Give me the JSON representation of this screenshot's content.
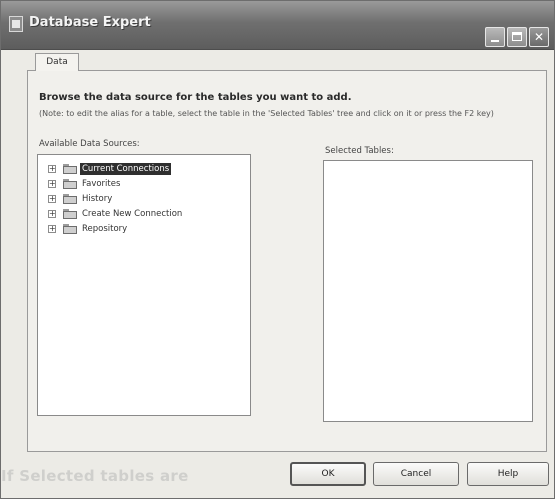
{
  "window": {
    "title": "Database Expert",
    "controls": {
      "minimize_icon": "minimize-icon",
      "maximize_icon": "maximize-icon",
      "close_label": "✕"
    }
  },
  "tabs": [
    {
      "label": "Data",
      "active": true
    }
  ],
  "panel": {
    "heading": "Browse the data source for the tables you want to add.",
    "instructions": "(Note: to edit the alias for a table, select the table in the 'Selected Tables' tree and click on it or press the F2 key)",
    "available_label": "Available Data Sources:",
    "selected_label": "Selected Tables:"
  },
  "tree": [
    {
      "label": "Current Connections",
      "selected": true,
      "expander": "+"
    },
    {
      "label": "Favorites",
      "selected": false,
      "expander": "+"
    },
    {
      "label": "History",
      "selected": false,
      "expander": "+"
    },
    {
      "label": "Create New Connection",
      "selected": false,
      "expander": "+"
    },
    {
      "label": "Repository",
      "selected": false,
      "expander": "+"
    }
  ],
  "selected_tables": [],
  "buttons": {
    "ok": "OK",
    "cancel": "Cancel",
    "help": "Help"
  },
  "footer_text": "If Selected tables are"
}
